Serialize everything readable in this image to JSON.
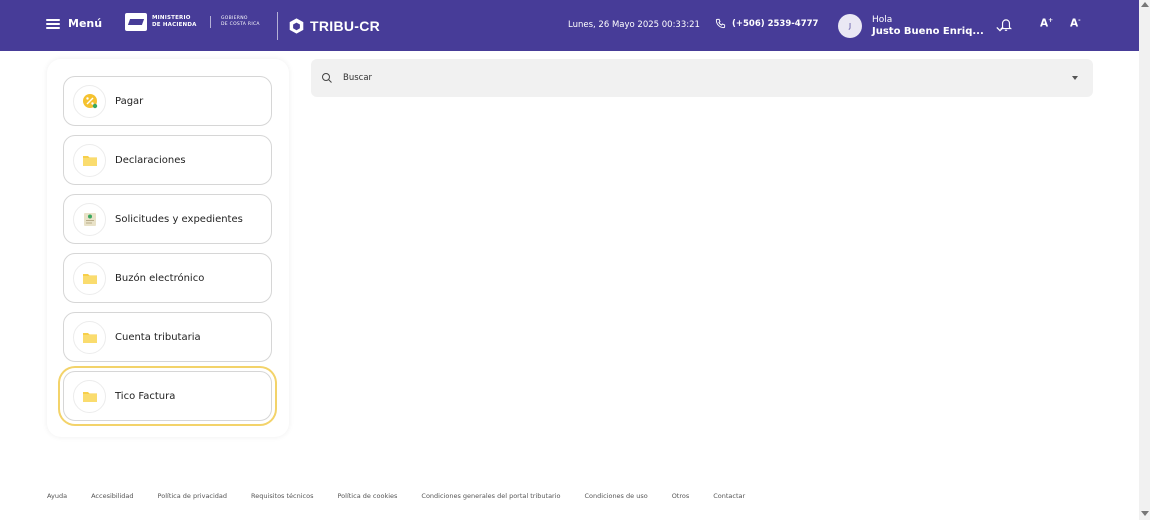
{
  "header": {
    "menu_label": "Menú",
    "logo_ministry_line1": "MINISTERIO",
    "logo_ministry_line2": "DE HACIENDA",
    "logo_gov_line1": "GOBIERNO",
    "logo_gov_line2": "DE COSTA RICA",
    "app_name": "TRIBU-CR",
    "datetime": "Lunes, 26 Mayo 2025 00:33:21",
    "phone": "(+506) 2539-4777",
    "greeting": "Hola",
    "user_name": "Justo Bueno Enriq...",
    "avatar_initial": "J",
    "font_increase": "A",
    "font_increase_sup": "+",
    "font_decrease": "A",
    "font_decrease_sup": "-"
  },
  "sidebar": {
    "items": [
      {
        "label": "Pagar",
        "icon": "pay-icon"
      },
      {
        "label": "Declaraciones",
        "icon": "folder-icon"
      },
      {
        "label": "Solicitudes y expedientes",
        "icon": "document-icon"
      },
      {
        "label": "Buzón electrónico",
        "icon": "folder-icon"
      },
      {
        "label": "Cuenta tributaria",
        "icon": "folder-icon"
      },
      {
        "label": "Tico Factura",
        "icon": "folder-icon",
        "active": true
      }
    ]
  },
  "search": {
    "placeholder": "Buscar"
  },
  "footer": {
    "links": [
      "Ayuda",
      "Accesibilidad",
      "Política de privacidad",
      "Requisitos técnicos",
      "Política de cookies",
      "Condiciones generales del portal tributario",
      "Condiciones de uso",
      "Otros",
      "Contactar"
    ]
  },
  "colors": {
    "header_bg": "#473c98",
    "folder": "#f7cf4a",
    "active_outline": "#f3d36a"
  }
}
